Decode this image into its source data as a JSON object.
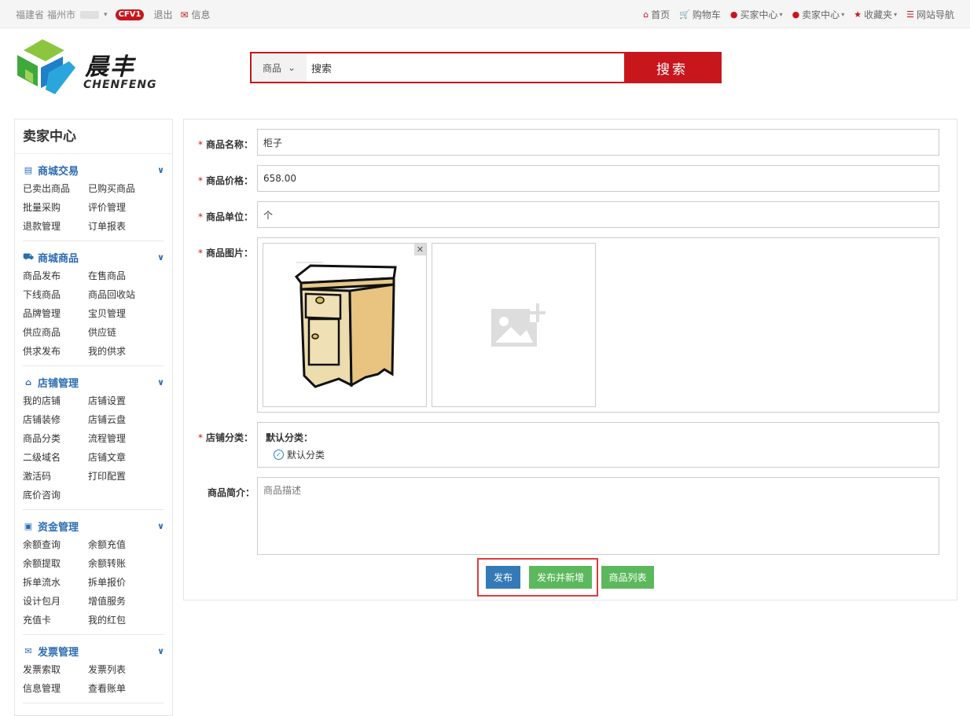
{
  "topbar": {
    "province": "福建省",
    "city": "福州市",
    "badge": "CFV1",
    "logout": "退出",
    "messages": "信息",
    "nav": [
      {
        "icon": "home-icon",
        "glyph": "⌂",
        "label": "首页",
        "dropdown": false
      },
      {
        "icon": "cart-icon",
        "glyph": "🛒",
        "label": "购物车",
        "dropdown": false
      },
      {
        "icon": "user-icon",
        "glyph": "●",
        "label": "买家中心",
        "dropdown": true
      },
      {
        "icon": "user-icon",
        "glyph": "●",
        "label": "卖家中心",
        "dropdown": true
      },
      {
        "icon": "star-icon",
        "glyph": "★",
        "label": "收藏夹",
        "dropdown": true
      },
      {
        "icon": "list-icon",
        "glyph": "☰",
        "label": "网站导航",
        "dropdown": false
      }
    ]
  },
  "logo": {
    "cn": "晨丰",
    "en": "CHENFENG"
  },
  "search": {
    "scope": "商品",
    "value": "搜索",
    "button": "搜索"
  },
  "sidebar": {
    "title": "卖家中心",
    "sections": [
      {
        "key": "mall-trade",
        "icon": "card-icon",
        "glyph": "▤",
        "title": "商城交易",
        "links": [
          "已卖出商品",
          "已购买商品",
          "批量采购",
          "评价管理",
          "退款管理",
          "订单报表"
        ]
      },
      {
        "key": "mall-goods",
        "icon": "truck-icon",
        "glyph": "⛟",
        "title": "商城商品",
        "links": [
          "商品发布",
          "在售商品",
          "下线商品",
          "商品回收站",
          "品牌管理",
          "宝贝管理",
          "供应商品",
          "供应链",
          "供求发布",
          "我的供求"
        ]
      },
      {
        "key": "shop-manage",
        "icon": "home-icon",
        "glyph": "⌂",
        "title": "店铺管理",
        "links": [
          "我的店铺",
          "店铺设置",
          "店铺装修",
          "店铺云盘",
          "商品分类",
          "流程管理",
          "二级域名",
          "店铺文章",
          "激活码",
          "打印配置",
          "底价咨询"
        ]
      },
      {
        "key": "fund-manage",
        "icon": "money-icon",
        "glyph": "▣",
        "title": "资金管理",
        "links": [
          "余额查询",
          "余额充值",
          "余额提取",
          "余额转账",
          "拆单流水",
          "拆单报价",
          "设计包月",
          "增值服务",
          "充值卡",
          "我的红包"
        ]
      },
      {
        "key": "invoice-manage",
        "icon": "envelope-icon",
        "glyph": "✉",
        "title": "发票管理",
        "links": [
          "发票索取",
          "发票列表",
          "信息管理",
          "查看账单"
        ]
      }
    ]
  },
  "form": {
    "name_label": "商品名称：",
    "name_value": "柜子",
    "price_label": "商品价格：",
    "price_value": "658.00",
    "unit_label": "商品单位：",
    "unit_value": "个",
    "image_label": "商品图片：",
    "category_label": "店铺分类：",
    "category_group": "默认分类：",
    "category_option": "默认分类",
    "intro_label": "商品简介：",
    "intro_placeholder": "商品描述",
    "required_mark": "*"
  },
  "actions": {
    "publish": "发布",
    "publish_new": "发布并新增",
    "list": "商品列表"
  },
  "colors": {
    "brand_red": "#c8161d",
    "link_blue": "#2b6bb3",
    "primary": "#337ab7",
    "success": "#5cb85c",
    "highlight": "#e03c3c"
  }
}
